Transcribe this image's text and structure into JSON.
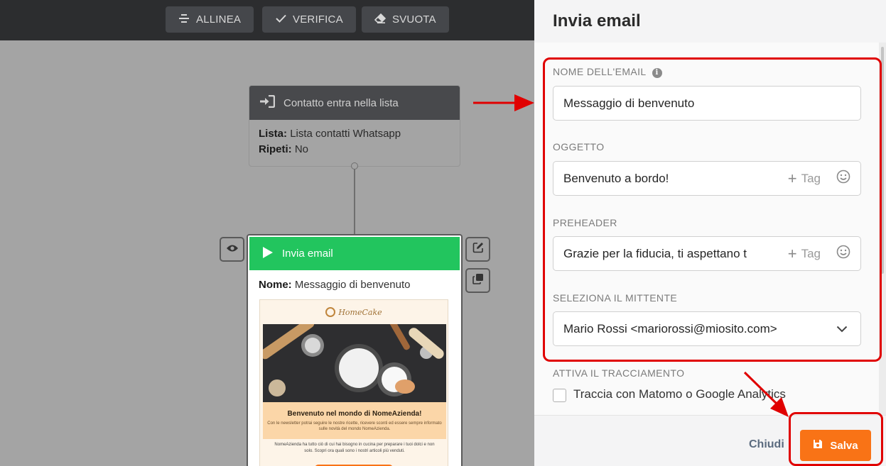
{
  "toolbar": {
    "align_label": "ALLINEA",
    "verify_label": "VERIFICA",
    "clear_label": "SVUOTA"
  },
  "trigger_node": {
    "title": "Contatto entra nella lista",
    "list_key": "Lista:",
    "list_value": "Lista contatti Whatsapp",
    "repeat_key": "Ripeti:",
    "repeat_value": "No"
  },
  "email_node": {
    "title": "Invia email",
    "name_key": "Nome:",
    "name_value": "Messaggio di benvenuto",
    "preview": {
      "brand": "HomeCake",
      "headline": "Benvenuto nel mondo di NomeAzienda!",
      "intro": "Con le newsletter potrai seguire le nostre ricette, ricevere sconti ed essere sempre informato sulle novità del mondo NomeAzienda.",
      "body": "NomeAzienda ha tutto ciò di cui hai bisogno in cucina per preparare i tuoi dolci e non solo. Scopri ora quali sono i nostri articoli più venduti."
    }
  },
  "panel": {
    "title": "Invia email",
    "email_name_label": "NOME DELL'EMAIL",
    "email_name_value": "Messaggio di benvenuto",
    "subject_label": "OGGETTO",
    "subject_value": "Benvenuto a bordo!",
    "preheader_label": "PREHEADER",
    "preheader_value": "Grazie per la fiducia, ti aspettano t",
    "tag_label": "Tag",
    "sender_label": "SELEZIONA IL MITTENTE",
    "sender_value": "Mario Rossi <mariorossi@miosito.com>",
    "tracking_label": "ATTIVA IL TRACCIAMENTO",
    "tracking_checkbox_label": "Traccia con Matomo o Google Analytics",
    "tracking_checked": false,
    "close_label": "Chiudi",
    "save_label": "Salva"
  },
  "colors": {
    "accent_orange": "#f97316",
    "node_green": "#22c55e",
    "annotation_red": "#e00000"
  }
}
